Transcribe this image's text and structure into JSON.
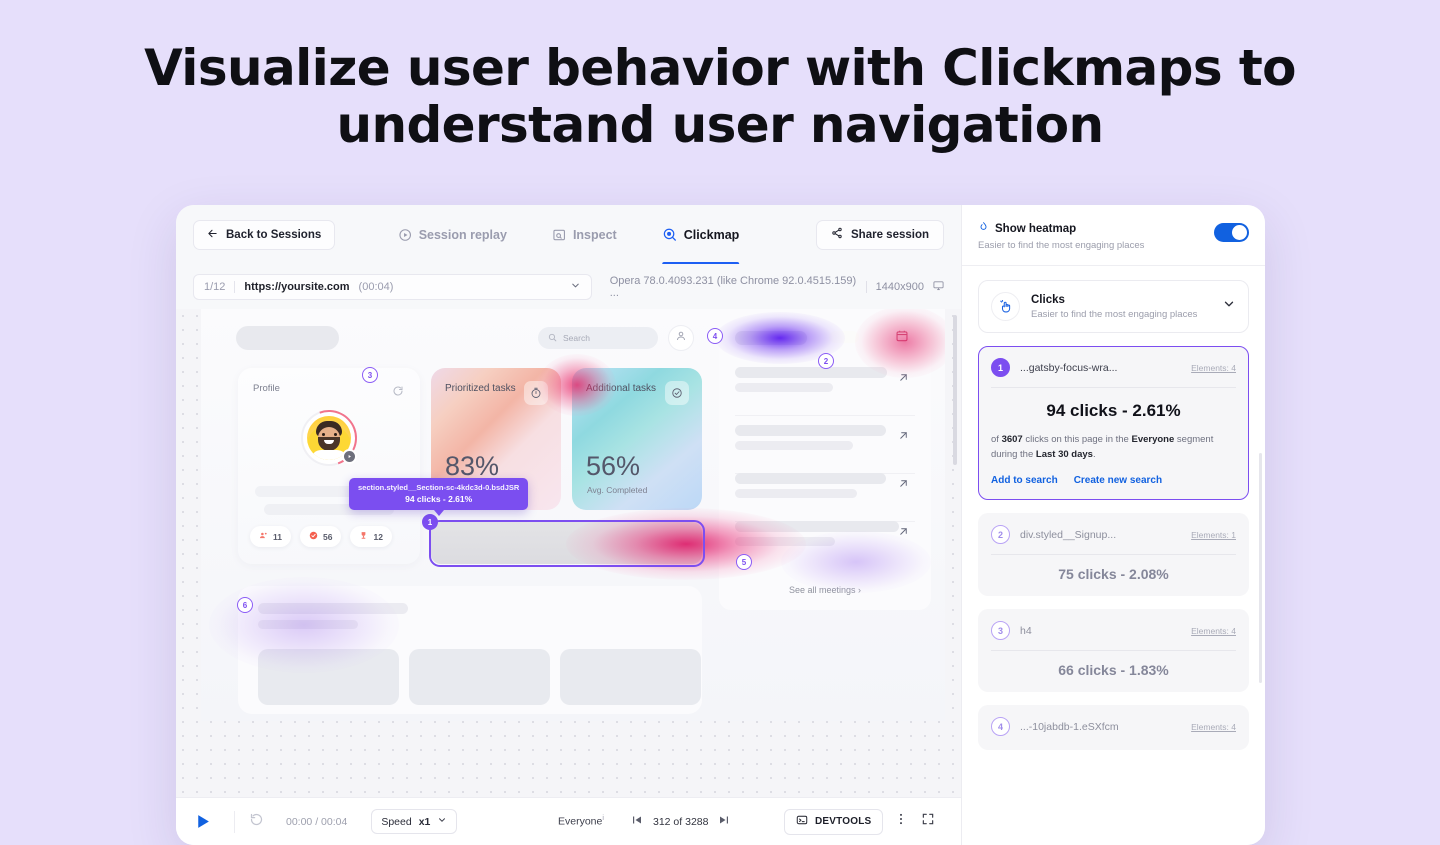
{
  "hero": {
    "headline": "Visualize user behavior with Clickmaps to understand user navigation"
  },
  "topnav": {
    "back_label": "Back to Sessions",
    "share_label": "Share session",
    "tabs": [
      {
        "label": "Session replay",
        "icon": "play-circle-icon",
        "active": false
      },
      {
        "label": "Inspect",
        "icon": "inspect-icon",
        "active": false
      },
      {
        "label": "Clickmap",
        "icon": "clickmap-icon",
        "active": true
      }
    ]
  },
  "urlbar": {
    "index": "1/12",
    "url": "https://yoursite.com",
    "time": "(00:04)",
    "browser": "Opera 78.0.4093.231 (like Chrome 92.0.4515.159) ...",
    "resolution": "1440x900"
  },
  "preview": {
    "logo_placeholder": "",
    "search_placeholder": "Search",
    "profile_card": {
      "label": "Profile",
      "stats": [
        {
          "icon": "people-icon",
          "value": "11"
        },
        {
          "icon": "target-icon",
          "value": "56"
        },
        {
          "icon": "trophy-icon",
          "value": "12"
        }
      ]
    },
    "task_cards": [
      {
        "title": "Prioritized tasks",
        "value": "83%",
        "sub": "",
        "icon": "timer-icon"
      },
      {
        "title": "Additional tasks",
        "value": "56%",
        "sub": "Avg. Completed",
        "icon": "check-circle-icon"
      }
    ],
    "meetings": {
      "see_all": "See all meetings"
    },
    "markers": [
      "1",
      "2",
      "3",
      "4",
      "5",
      "6"
    ],
    "tooltip": {
      "selector": "section.styled__Section-sc-4kdc3d-0.bsdJSR",
      "stats": "94 clicks - 2.61%"
    }
  },
  "player": {
    "time": "00:00 / 00:04",
    "speed_label": "Speed",
    "speed_value": "x1",
    "segment": "Everyone",
    "pager": "312 of 3288",
    "devtools": "DEVTOOLS"
  },
  "sidebar": {
    "heatmap": {
      "title": "Show heatmap",
      "subtitle": "Easier to find the most engaging places",
      "enabled": true
    },
    "mode": {
      "title": "Clicks",
      "subtitle": "Easier to find the most engaging places"
    },
    "elements": [
      {
        "rank": "1",
        "selector": "...gatsby-focus-wra...",
        "elements_label": "Elements: 4",
        "stats": "94 clicks - 2.61%",
        "description_parts": {
          "prefix": "of ",
          "total": "3607",
          "mid": " clicks on this page in the ",
          "segment": "Everyone",
          "mid2": " segment during the ",
          "period": "Last 30 days",
          "suffix": "."
        },
        "add_to_search": "Add to search",
        "create_new_search": "Create new search",
        "selected": true
      },
      {
        "rank": "2",
        "selector": "div.styled__Signup...",
        "elements_label": "Elements: 1",
        "stats": "75 clicks - 2.08%",
        "selected": false
      },
      {
        "rank": "3",
        "selector": "h4",
        "elements_label": "Elements: 4",
        "stats": "66 clicks - 1.83%",
        "selected": false
      },
      {
        "rank": "4",
        "selector": "...-10jabdb-1.eSXfcm",
        "elements_label": "Elements: 4",
        "stats": "",
        "selected": false
      }
    ]
  },
  "colors": {
    "page_bg": "#e6dffb",
    "accent_blue": "#1161e0",
    "accent_purple": "#7c4ef0",
    "heat_red": "#de0e60"
  }
}
